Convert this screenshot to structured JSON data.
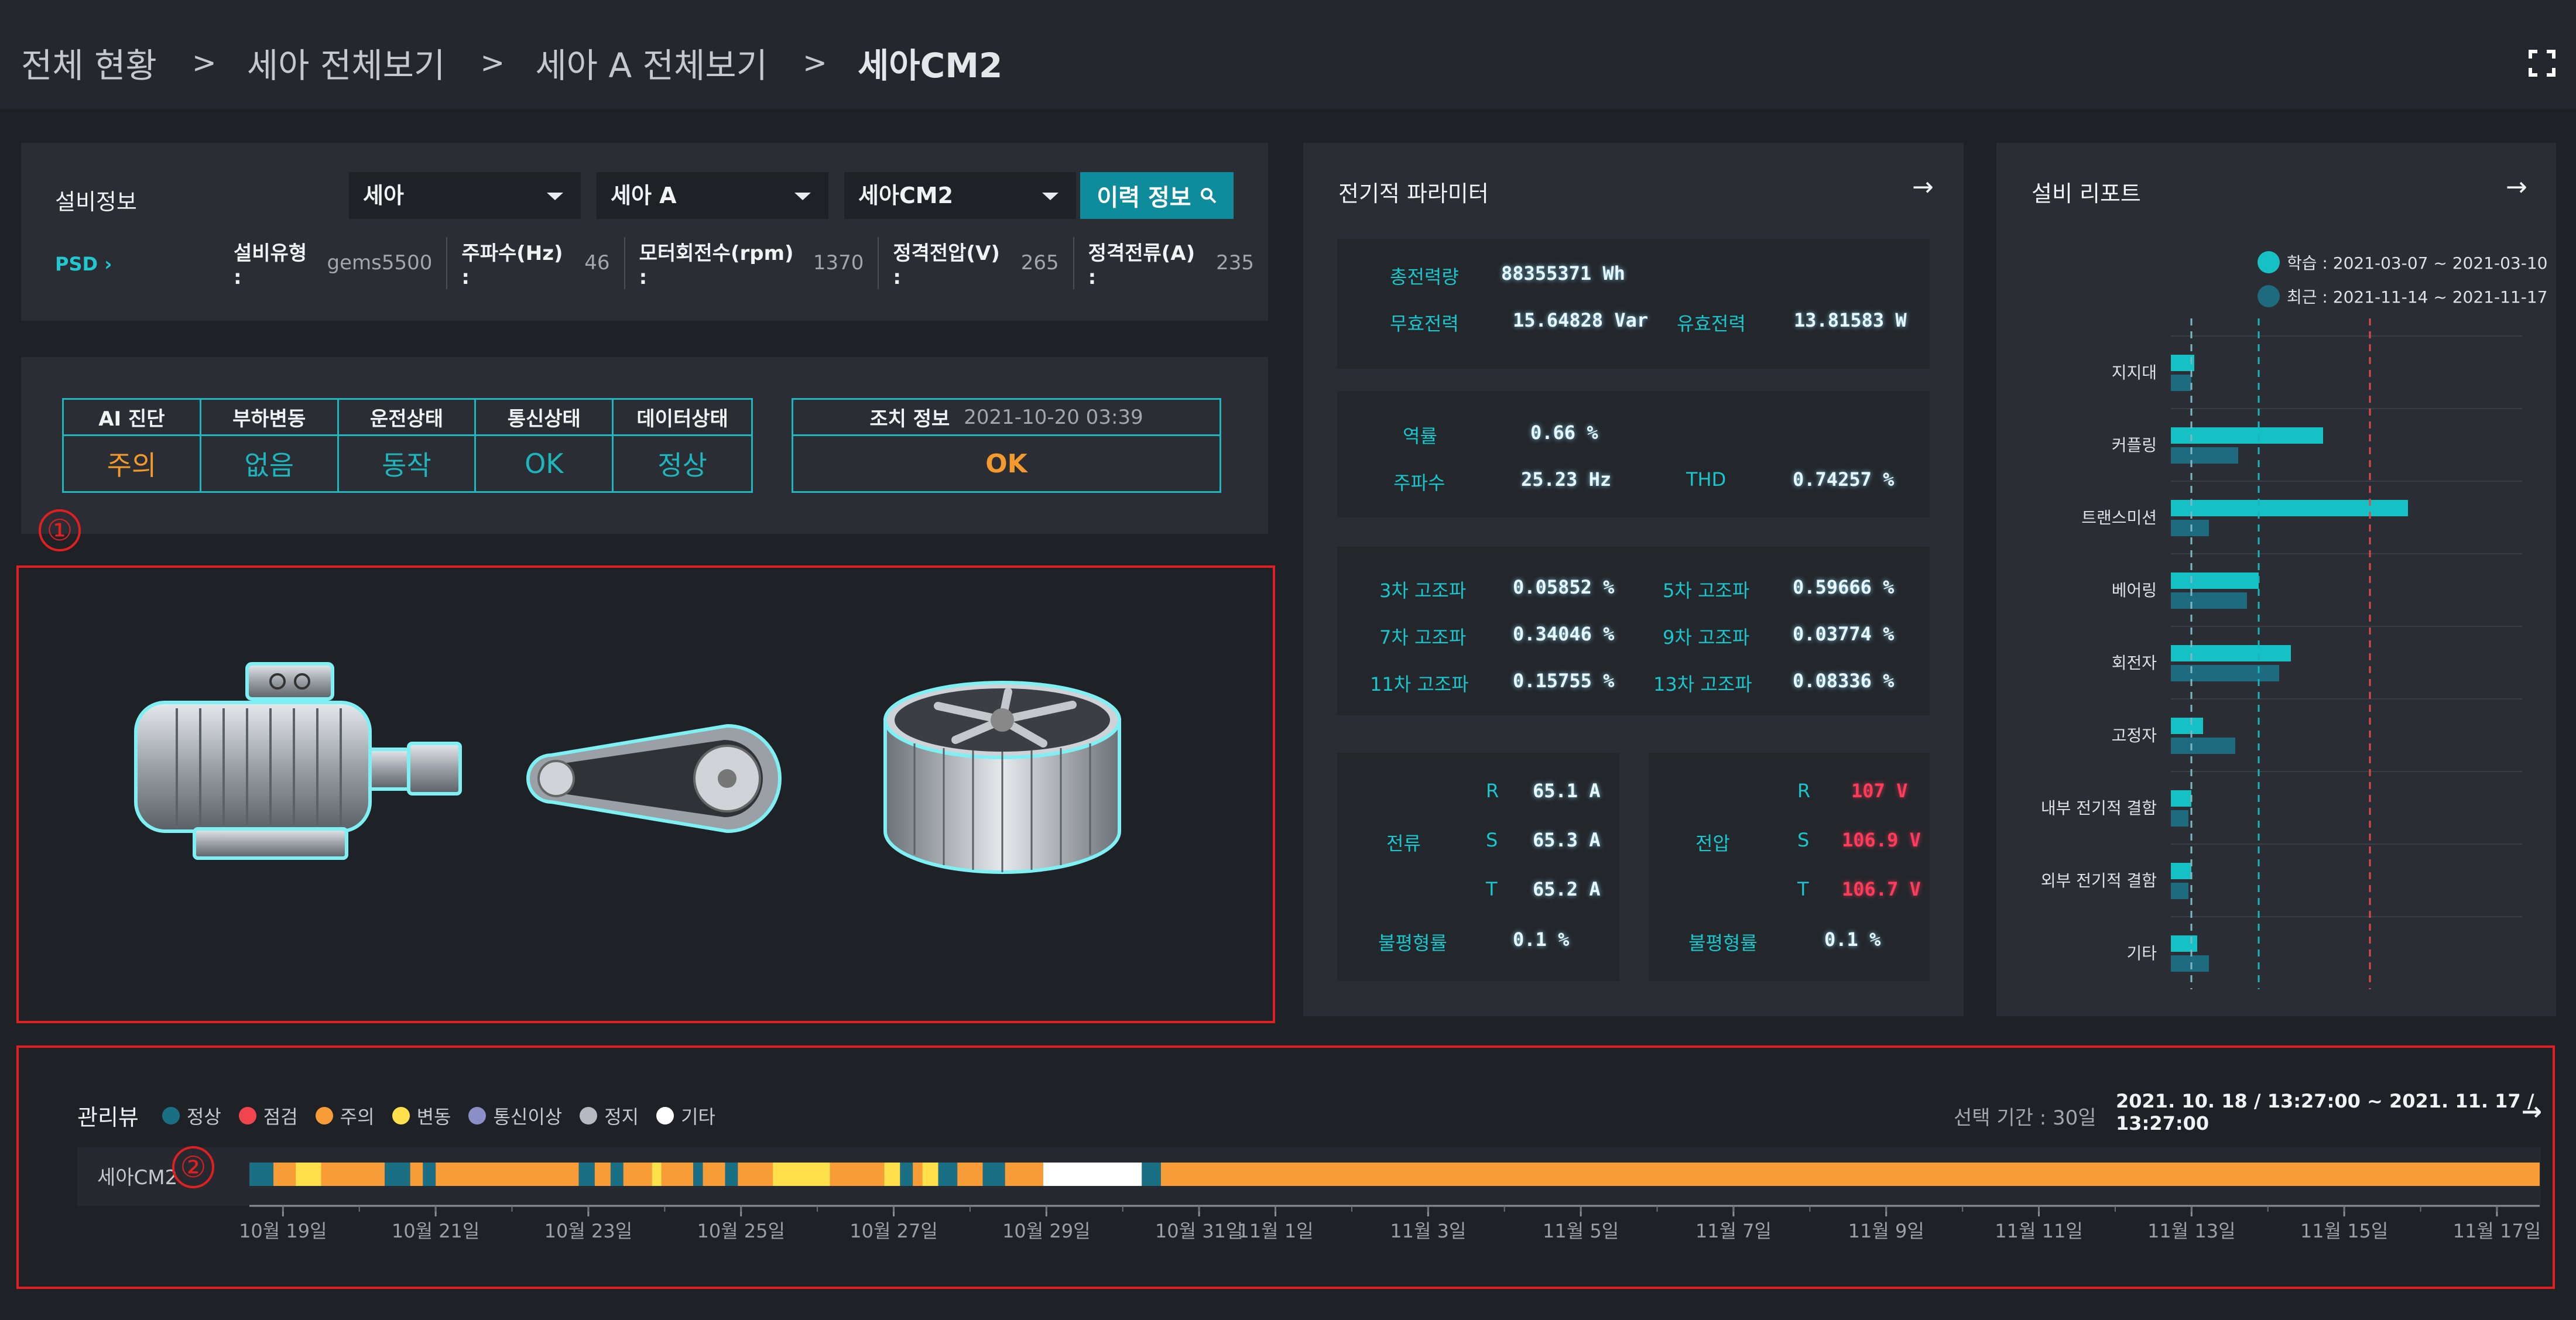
{
  "breadcrumb": [
    "전체 현황",
    "세아 전체보기",
    "세아 A 전체보기",
    "세아CM2"
  ],
  "equipment_info": {
    "title": "설비정보",
    "selects": [
      "세아",
      "세아 A",
      "세아CM2"
    ],
    "history_button": "이력 정보",
    "psd_link": "PSD",
    "specs": [
      {
        "label": "설비유형 :",
        "value": "gems5500"
      },
      {
        "label": "주파수(Hz) :",
        "value": "46"
      },
      {
        "label": "모터회전수(rpm) :",
        "value": "1370"
      },
      {
        "label": "정격전압(V) :",
        "value": "265"
      },
      {
        "label": "정격전류(A) :",
        "value": "235"
      }
    ]
  },
  "status": {
    "headers": [
      "AI 진단",
      "부하변동",
      "운전상태",
      "통신상태",
      "데이터상태"
    ],
    "values": [
      "주의",
      "없음",
      "동작",
      "OK",
      "정상"
    ],
    "value_colors": [
      "#f39a2c",
      "#1fb5bd",
      "#1fb5bd",
      "#1fb5bd",
      "#1fb5bd"
    ],
    "action_label": "조치 정보",
    "action_time": "2021-10-20 03:39",
    "action_value": "OK"
  },
  "annotations": [
    "①",
    "②"
  ],
  "equipment_icons": [
    "motor-icon",
    "belt-drive-icon",
    "fan-icon"
  ],
  "electrical": {
    "title": "전기적 파라미터",
    "total_power": {
      "label": "총전력량",
      "value": "88355371 Wh"
    },
    "reactive_power": {
      "label": "무효전력",
      "value": "15.64828 Var"
    },
    "active_power": {
      "label": "유효전력",
      "value": "13.81583 W"
    },
    "power_factor": {
      "label": "역률",
      "value": "0.66 %"
    },
    "frequency": {
      "label": "주파수",
      "value": "25.23 Hz"
    },
    "thd": {
      "label": "THD",
      "value": "0.74257 %"
    },
    "harmonics": [
      {
        "label": "3차 고조파",
        "value": "0.05852 %"
      },
      {
        "label": "5차 고조파",
        "value": "0.59666 %"
      },
      {
        "label": "7차 고조파",
        "value": "0.34046 %"
      },
      {
        "label": "9차 고조파",
        "value": "0.03774 %"
      },
      {
        "label": "11차 고조파",
        "value": "0.15755 %"
      },
      {
        "label": "13차 고조파",
        "value": "0.08336 %"
      }
    ],
    "current": {
      "label": "전류",
      "phases": [
        "R",
        "S",
        "T"
      ],
      "values": [
        "65.1 A",
        "65.3 A",
        "65.2 A"
      ],
      "unbalance_label": "불평형률",
      "unbalance": "0.1 %"
    },
    "voltage": {
      "label": "전압",
      "phases": [
        "R",
        "S",
        "T"
      ],
      "values": [
        "107 V",
        "106.9 V",
        "106.7 V"
      ],
      "unbalance_label": "불평형률",
      "unbalance": "0.1 %"
    }
  },
  "report": {
    "title": "설비 리포트",
    "legend": [
      {
        "label": "학습 : 2021-03-07 ~ 2021-03-10",
        "color": "#15c1c5"
      },
      {
        "label": "최근 : 2021-11-14 ~ 2021-11-17",
        "color": "#1e6b80"
      }
    ]
  },
  "chart_data": {
    "type": "bar",
    "orientation": "horizontal",
    "categories": [
      "지지대",
      "커플링",
      "트랜스미션",
      "베어링",
      "회전자",
      "고정자",
      "내부 전기적 결함",
      "외부 전기적 결함",
      "기타"
    ],
    "series": [
      {
        "name": "학습",
        "color": "#15c1c5",
        "values": [
          0.08,
          0.52,
          0.81,
          0.3,
          0.41,
          0.11,
          0.07,
          0.07,
          0.09
        ]
      },
      {
        "name": "최근",
        "color": "#1e6b80",
        "values": [
          0.07,
          0.23,
          0.13,
          0.26,
          0.37,
          0.22,
          0.06,
          0.06,
          0.13
        ]
      }
    ],
    "thresholds": [
      {
        "value": 0.07,
        "color": "#7fb8c4"
      },
      {
        "value": 0.3,
        "color": "#16b6bd"
      },
      {
        "value": 0.68,
        "color": "#e0484c"
      }
    ],
    "xlim": [
      0,
      1
    ]
  },
  "management": {
    "title": "관리뷰",
    "legend": [
      {
        "label": "정상",
        "color": "#1a6f84"
      },
      {
        "label": "점검",
        "color": "#f0454f"
      },
      {
        "label": "주의",
        "color": "#f79c36"
      },
      {
        "label": "변동",
        "color": "#ffe04a"
      },
      {
        "label": "통신이상",
        "color": "#8c8fc7"
      },
      {
        "label": "정지",
        "color": "#b6b9c2"
      },
      {
        "label": "기타",
        "color": "#ffffff"
      }
    ],
    "period_label": "선택 기간 : 30일",
    "range": "2021. 10. 18 / 13:27:00 ~ 2021. 11. 17 / 13:27:00",
    "row_label": "세아CM2",
    "timeline": {
      "start": "2021-10-18 13:27",
      "days": 30,
      "segments": [
        {
          "from": "2021-10-18 13:27",
          "to": "2021-10-18 21:00",
          "state": "정상"
        },
        {
          "from": "2021-10-18 21:00",
          "to": "2021-10-19 04:00",
          "state": "주의"
        },
        {
          "from": "2021-10-19 04:00",
          "to": "2021-10-19 12:00",
          "state": "변동"
        },
        {
          "from": "2021-10-19 12:00",
          "to": "2021-10-20 08:00",
          "state": "주의"
        },
        {
          "from": "2021-10-20 08:00",
          "to": "2021-10-20 16:00",
          "state": "정상"
        },
        {
          "from": "2021-10-20 16:00",
          "to": "2021-10-20 20:00",
          "state": "주의"
        },
        {
          "from": "2021-10-20 20:00",
          "to": "2021-10-21 00:00",
          "state": "정상"
        },
        {
          "from": "2021-10-21 00:00",
          "to": "2021-10-22 21:00",
          "state": "주의"
        },
        {
          "from": "2021-10-22 21:00",
          "to": "2021-10-23 02:00",
          "state": "정상"
        },
        {
          "from": "2021-10-23 02:00",
          "to": "2021-10-23 07:00",
          "state": "주의"
        },
        {
          "from": "2021-10-23 07:00",
          "to": "2021-10-23 11:00",
          "state": "정상"
        },
        {
          "from": "2021-10-23 11:00",
          "to": "2021-10-23 20:00",
          "state": "주의"
        },
        {
          "from": "2021-10-23 20:00",
          "to": "2021-10-23 23:00",
          "state": "변동"
        },
        {
          "from": "2021-10-23 23:00",
          "to": "2021-10-24 09:00",
          "state": "주의"
        },
        {
          "from": "2021-10-24 09:00",
          "to": "2021-10-24 12:00",
          "state": "정상"
        },
        {
          "from": "2021-10-24 12:00",
          "to": "2021-10-24 19:00",
          "state": "주의"
        },
        {
          "from": "2021-10-24 19:00",
          "to": "2021-10-24 23:00",
          "state": "정상"
        },
        {
          "from": "2021-10-24 23:00",
          "to": "2021-10-25 10:00",
          "state": "주의"
        },
        {
          "from": "2021-10-25 10:00",
          "to": "2021-10-26 04:00",
          "state": "변동"
        },
        {
          "from": "2021-10-26 04:00",
          "to": "2021-10-26 21:00",
          "state": "주의"
        },
        {
          "from": "2021-10-26 21:00",
          "to": "2021-10-27 02:00",
          "state": "변동"
        },
        {
          "from": "2021-10-27 02:00",
          "to": "2021-10-27 06:00",
          "state": "정상"
        },
        {
          "from": "2021-10-27 06:00",
          "to": "2021-10-27 09:00",
          "state": "주의"
        },
        {
          "from": "2021-10-27 09:00",
          "to": "2021-10-27 14:00",
          "state": "변동"
        },
        {
          "from": "2021-10-27 14:00",
          "to": "2021-10-27 20:00",
          "state": "정상"
        },
        {
          "from": "2021-10-27 20:00",
          "to": "2021-10-28 04:00",
          "state": "주의"
        },
        {
          "from": "2021-10-28 04:00",
          "to": "2021-10-28 11:00",
          "state": "정상"
        },
        {
          "from": "2021-10-28 11:00",
          "to": "2021-10-28 23:00",
          "state": "주의"
        },
        {
          "from": "2021-10-28 23:00",
          "to": "2021-10-30 06:00",
          "state": "기타"
        },
        {
          "from": "2021-10-30 06:00",
          "to": "2021-10-30 12:00",
          "state": "정상"
        },
        {
          "from": "2021-10-30 12:00",
          "to": "2021-11-17 13:27",
          "state": "주의"
        }
      ]
    },
    "axis_labels": [
      "10월 19일",
      "10월 21일",
      "10월 23일",
      "10월 25일",
      "10월 27일",
      "10월 29일",
      "10월 31일",
      "11월 1일",
      "11월 3일",
      "11월 5일",
      "11월 7일",
      "11월 9일",
      "11월 11일",
      "11월 13일",
      "11월 15일",
      "11월 17일"
    ]
  }
}
